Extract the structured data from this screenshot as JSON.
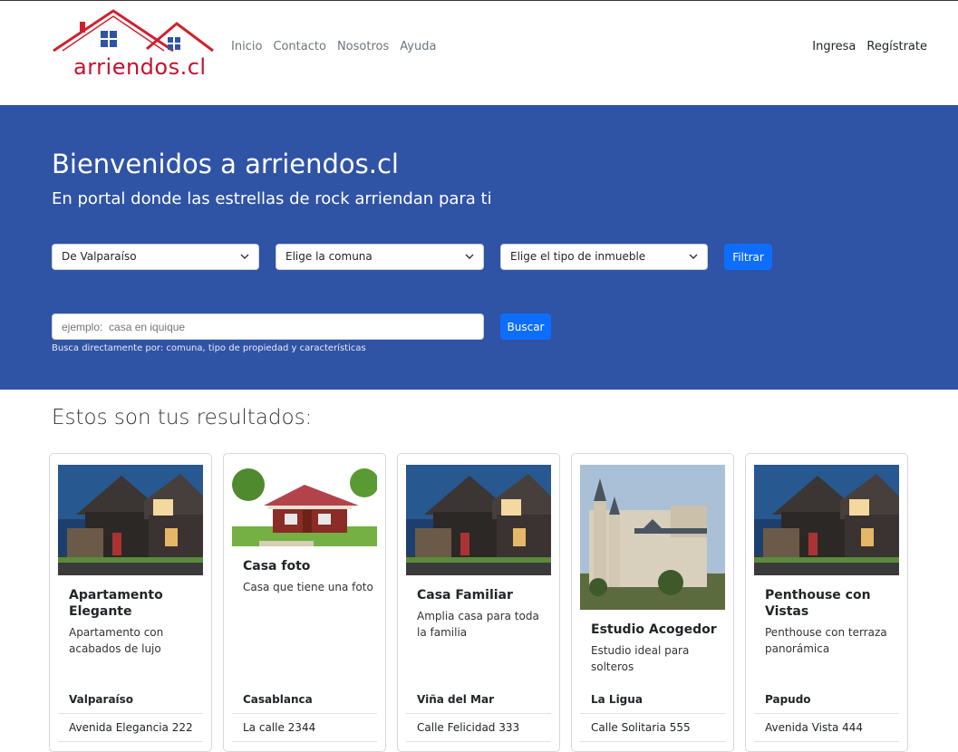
{
  "brand": {
    "logo_text": "arriendos.cl"
  },
  "nav": {
    "links": [
      "Inicio",
      "Contacto",
      "Nosotros",
      "Ayuda"
    ],
    "right": [
      "Ingresa",
      "Regístrate"
    ]
  },
  "hero": {
    "title": "Bienvenidos a arriendos.cl",
    "subtitle": "En portal donde las estrellas de rock arriendan para ti",
    "region_select": "De Valparaíso",
    "comuna_select": "Elige la comuna",
    "tipo_select": "Elige el tipo de inmueble",
    "filter_button": "Filtrar",
    "search_placeholder": "ejemplo:  casa en iquique",
    "search_button": "Buscar",
    "search_help": "Busca directamente por: comuna, tipo de propiedad y características"
  },
  "results": {
    "title": "Estos son tus resultados:",
    "cards": [
      {
        "title": "Apartamento Elegante",
        "desc": "Apartamento con acabados de lujo",
        "city": "Valparaíso",
        "address": "Avenida Elegancia 222",
        "image": "modern-house"
      },
      {
        "title": "Casa foto",
        "desc": "Casa que tiene una foto",
        "city": "Casablanca",
        "address": "La calle 2344",
        "image": "cabin"
      },
      {
        "title": "Casa Familiar",
        "desc": "Amplia casa para toda la familia",
        "city": "Viña del Mar",
        "address": "Calle Felicidad 333",
        "image": "modern-house"
      },
      {
        "title": "Estudio Acogedor",
        "desc": "Estudio ideal para solteros",
        "city": "La Ligua",
        "address": "Calle Solitaria 555",
        "image": "castle"
      },
      {
        "title": "Penthouse con Vistas",
        "desc": "Penthouse con terraza panorámica",
        "city": "Papudo",
        "address": "Avenida Vista 444",
        "image": "modern-house"
      }
    ]
  },
  "colors": {
    "hero_bg": "#2f53a5",
    "primary": "#0d6efd",
    "logo_red": "#c8102e",
    "logo_blue": "#2f53a5"
  }
}
